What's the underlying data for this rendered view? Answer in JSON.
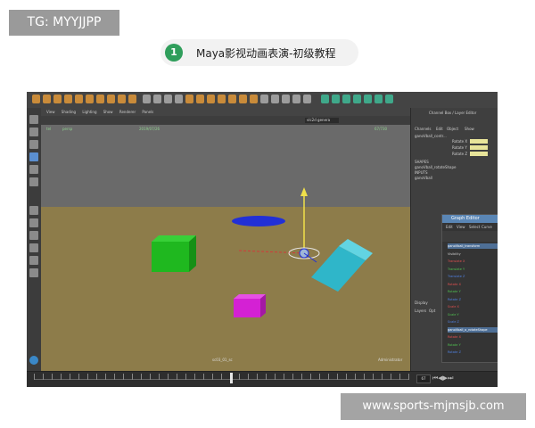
{
  "tag": {
    "text": "TG: MYYJJPP"
  },
  "header": {
    "number": "1",
    "title": "Maya影视动画表演-初级教程"
  },
  "maya": {
    "viewport_menu": [
      "View",
      "Shading",
      "Lighting",
      "Show",
      "Renderer",
      "Panels"
    ],
    "hud": {
      "top_left_a": "tel",
      "top_left_b": "persp",
      "top_mid": "2019/07/26",
      "top_right": "67/730",
      "bottom_mid": "sc03_01_sc",
      "bottom_right": "Administrator"
    },
    "camera_field": "vlc2d genera",
    "right_panel": {
      "header": "Channel Box / Layer Editor",
      "tabs": [
        "Channels",
        "Edit",
        "Object",
        "Show"
      ],
      "object": "ganoVball_contr...",
      "attrs": [
        "Rotate X",
        "Rotate Y",
        "Rotate Z"
      ],
      "shapes_title": "SHAPES",
      "shape_item": "ganoVball_rotateShape",
      "inputs_title": "INPUTS",
      "input_item": "ganoVball",
      "display_tab": "Display",
      "layers_tabs": [
        "Layers",
        "Opt"
      ]
    },
    "graph_editor": {
      "title": "Graph Editor",
      "menu": [
        "Edit",
        "View",
        "Select",
        "Curve"
      ],
      "rows": [
        {
          "label": "ganoVball_transform",
          "selected": true,
          "color": "#ffffff"
        },
        {
          "label": "Visibility",
          "selected": false,
          "color": "#cccccc"
        },
        {
          "label": "Translate X",
          "selected": false,
          "color": "#e05050"
        },
        {
          "label": "Translate Y",
          "selected": false,
          "color": "#50c050"
        },
        {
          "label": "Translate Z",
          "selected": false,
          "color": "#5080e0"
        },
        {
          "label": "Rotate X",
          "selected": false,
          "color": "#e05050"
        },
        {
          "label": "Rotate Y",
          "selected": false,
          "color": "#50c050"
        },
        {
          "label": "Rotate Z",
          "selected": false,
          "color": "#5080e0"
        },
        {
          "label": "Scale X",
          "selected": false,
          "color": "#e05050"
        },
        {
          "label": "Scale Y",
          "selected": false,
          "color": "#50c050"
        },
        {
          "label": "Scale Z",
          "selected": false,
          "color": "#5080e0"
        },
        {
          "label": "ganoVball_o_rotateShape",
          "selected": true,
          "color": "#ffffff"
        },
        {
          "label": "Rotate X",
          "selected": false,
          "color": "#e05050"
        },
        {
          "label": "Rotate Y",
          "selected": false,
          "color": "#50c050"
        },
        {
          "label": "Rotate Z",
          "selected": false,
          "color": "#5080e0"
        }
      ]
    },
    "timeline": {
      "current_frame": "67"
    },
    "colors": {
      "ground": "#8d7c4a",
      "sky": "#6a6a6a",
      "green_cube": "#1fb81f",
      "cyan_box": "#2fb6c9",
      "magenta_box": "#d421d4",
      "blue_disc": "#2230d6",
      "accent": "#5b8fd0"
    }
  },
  "caption": {
    "text": "www.sports-mjmsjb.com"
  }
}
